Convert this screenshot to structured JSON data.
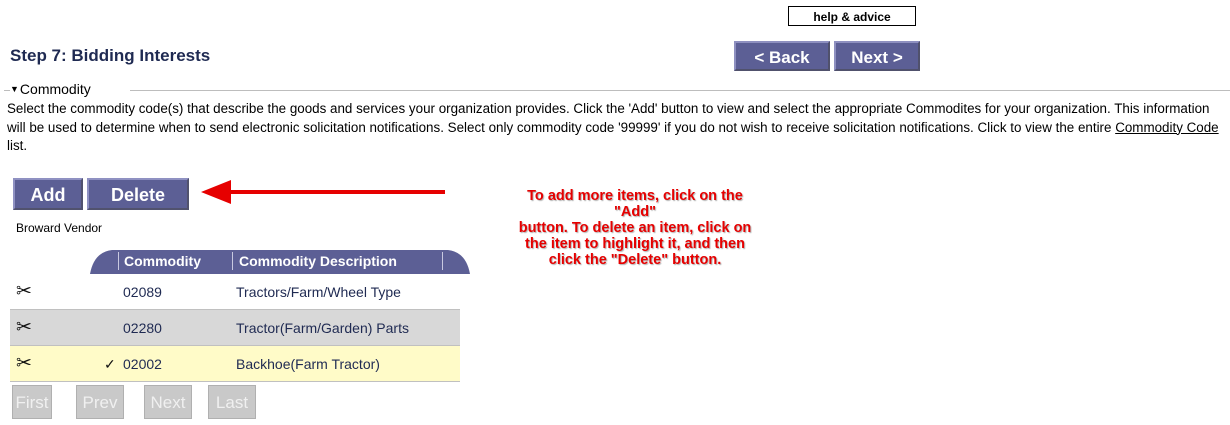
{
  "header": {
    "help_label": "help & advice",
    "step_title": "Step 7: Bidding Interests",
    "back_label": "< Back",
    "next_label": "Next >"
  },
  "commodity": {
    "legend": "Commodity",
    "desc_1": "Select the commodity code(s) that describe the goods and services your organization provides. Click the 'Add' button to view and select the appropriate Commodites for your organization. This information will be used to determine when to send electronic solicitation notifications. Select only commodity code '99999' if you do not wish to receive solicitation notifications. Click to view the entire ",
    "desc_link": "Commodity Code",
    "desc_2": " list.",
    "add_label": "Add",
    "delete_label": "Delete",
    "vendor_label": "Broward Vendor"
  },
  "table": {
    "columns": [
      "Commodity",
      "Commodity Description"
    ],
    "rows": [
      {
        "code": "02089",
        "description": "Tractors/Farm/Wheel Type",
        "check": ""
      },
      {
        "code": "02280",
        "description": "Tractor(Farm/Garden) Parts",
        "check": ""
      },
      {
        "code": "02002",
        "description": "Backhoe(Farm Tractor)",
        "check": "✓"
      }
    ]
  },
  "pager": {
    "first": "First",
    "prev": "Prev",
    "next": "Next",
    "last": "Last"
  },
  "annotation": {
    "line1": "To add more items, click on the",
    "line2": "\"Add\"",
    "line3": "button.  To delete an item, click on",
    "line4": "the item to highlight it, and then",
    "line5": "click the \"Delete\" button."
  },
  "colors": {
    "button_purple": "#5c5f95",
    "callout_red": "#e60000",
    "selected_row": "#fffbc8",
    "alt_row": "#d8d8d8"
  }
}
